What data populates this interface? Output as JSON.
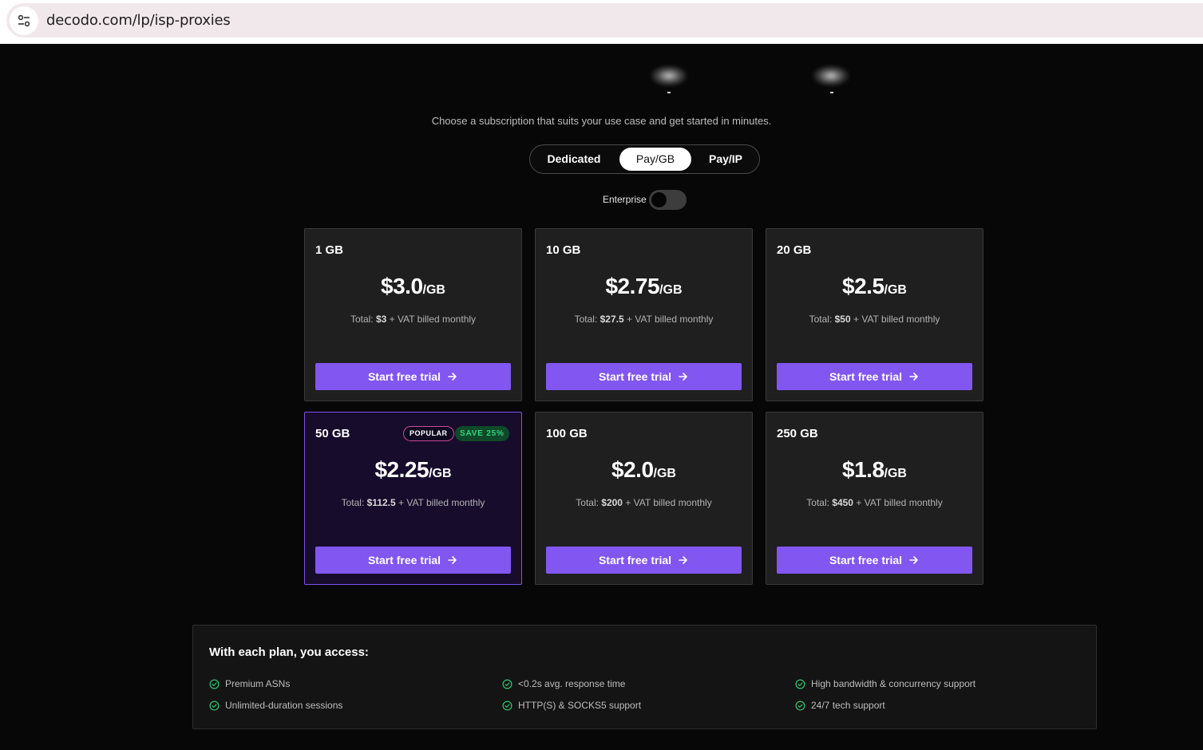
{
  "browser": {
    "url": "decodo.com/lp/isp-proxies"
  },
  "header": {
    "subtitle": "Choose a subscription that suits your use case and get started in minutes."
  },
  "tabs": [
    {
      "label": "Dedicated",
      "active": false
    },
    {
      "label": "Pay/GB",
      "active": true
    },
    {
      "label": "Pay/IP",
      "active": false
    }
  ],
  "enterprise": {
    "label": "Enterprise",
    "enabled": false
  },
  "plans": [
    {
      "size": "1 GB",
      "price": "$3.0",
      "unit": "/GB",
      "total_prefix": "Total: ",
      "total": "$3",
      "total_suffix": " + VAT billed monthly",
      "cta": "Start free trial"
    },
    {
      "size": "10 GB",
      "price": "$2.75",
      "unit": "/GB",
      "total_prefix": "Total: ",
      "total": "$27.5",
      "total_suffix": " + VAT billed monthly",
      "cta": "Start free trial"
    },
    {
      "size": "20 GB",
      "price": "$2.5",
      "unit": "/GB",
      "total_prefix": "Total: ",
      "total": "$50",
      "total_suffix": " + VAT billed monthly",
      "cta": "Start free trial"
    },
    {
      "size": "50 GB",
      "price": "$2.25",
      "unit": "/GB",
      "total_prefix": "Total: ",
      "total": "$112.5",
      "total_suffix": " + VAT billed monthly",
      "cta": "Start free trial",
      "badge_popular": "POPULAR",
      "badge_save": "SAVE 25%"
    },
    {
      "size": "100 GB",
      "price": "$2.0",
      "unit": "/GB",
      "total_prefix": "Total: ",
      "total": "$200",
      "total_suffix": " + VAT billed monthly",
      "cta": "Start free trial"
    },
    {
      "size": "250 GB",
      "price": "$1.8",
      "unit": "/GB",
      "total_prefix": "Total: ",
      "total": "$450",
      "total_suffix": " + VAT billed monthly",
      "cta": "Start free trial"
    }
  ],
  "features": {
    "title": "With each plan, you access:",
    "items": [
      "Premium ASNs",
      "Unlimited-duration sessions",
      "<0.2s avg. response time",
      "HTTP(S) & SOCKS5 support",
      "High bandwidth & concurrency support",
      "24/7 tech support"
    ]
  },
  "colors": {
    "accent": "#8256f0",
    "popular_border": "#7b53e8",
    "check_green": "#35c46a",
    "background": "#070707"
  },
  "icons": {
    "site_info": "tune-icon",
    "cta_arrow": "arrow-right-icon",
    "feature_check": "check-circle-icon"
  }
}
